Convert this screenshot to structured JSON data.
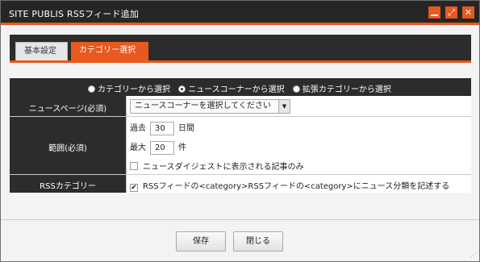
{
  "window": {
    "title": "SITE PUBLIS RSSフィード追加",
    "controls": [
      "minimize-icon",
      "maximize-icon",
      "close-icon"
    ]
  },
  "tabs": [
    {
      "label": "基本設定",
      "active": false
    },
    {
      "label": "カテゴリー選択",
      "active": true
    }
  ],
  "source_options": [
    {
      "label": "カテゴリーから選択",
      "checked": false
    },
    {
      "label": "ニュースコーナーから選択",
      "checked": true
    },
    {
      "label": "拡張カテゴリーから選択",
      "checked": false
    }
  ],
  "form": {
    "news_page": {
      "label": "ニュースページ(必須)",
      "select_value": "ニュースコーナーを選択してください"
    },
    "range": {
      "label": "範囲(必須)",
      "past_prefix": "過去",
      "past_value": "30",
      "past_unit": "日間",
      "max_prefix": "最大",
      "max_value": "20",
      "max_unit": "件",
      "digest_only_label": "ニュースダイジェストに表示される記事のみ",
      "digest_only_checked": false
    },
    "rss_category": {
      "label": "RSSカテゴリー",
      "checkbox_label": "RSSフィードの<category>RSSフィードの<category>にニュース分類を記述する",
      "checked": true
    }
  },
  "buttons": {
    "save": "保存",
    "close": "閉じる"
  },
  "colors": {
    "accent": "#e8581f",
    "dark": "#2c2c2c",
    "titlebar": "#262626"
  }
}
